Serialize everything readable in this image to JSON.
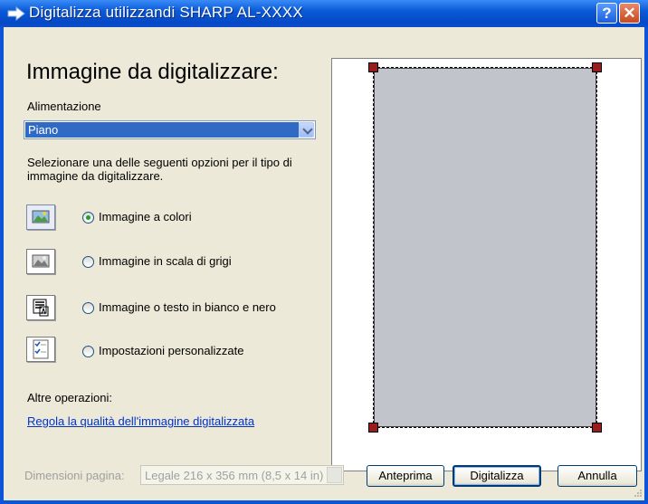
{
  "window": {
    "title": "Digitalizza utilizzandi SHARP AL-XXXX",
    "help_label": "?",
    "close_label": "✕"
  },
  "heading": "Immagine da digitalizzare:",
  "source": {
    "label": "Alimentazione",
    "selected": "Piano"
  },
  "instructions": "Selezionare una delle seguenti opzioni per il tipo di immagine da digitalizzare.",
  "image_options": [
    {
      "label": "Immagine a colori",
      "icon": "color-picture-icon",
      "checked": true
    },
    {
      "label": "Immagine in scala di grigi",
      "icon": "grayscale-picture-icon",
      "checked": false
    },
    {
      "label": "Immagine o testo in bianco e nero",
      "icon": "black-white-text-icon",
      "checked": false
    },
    {
      "label": "Impostazioni personalizzate",
      "icon": "custom-settings-icon",
      "checked": false
    }
  ],
  "other_ops": {
    "label": "Altre operazioni:",
    "link": "Regola la qualità dell'immagine digitalizzata"
  },
  "page_size": {
    "label": "Dimensioni pagina:",
    "value": "Legale 216 x 356 mm (8,5 x 14 in)"
  },
  "buttons": {
    "preview": "Anteprima",
    "scan": "Digitalizza",
    "cancel": "Annulla"
  },
  "colors": {
    "title_bar": "#0a5ad8",
    "dialog_bg": "#ece9d8",
    "selection": "#316ac5",
    "link": "#0033cc",
    "handle": "#9a1c1c"
  }
}
